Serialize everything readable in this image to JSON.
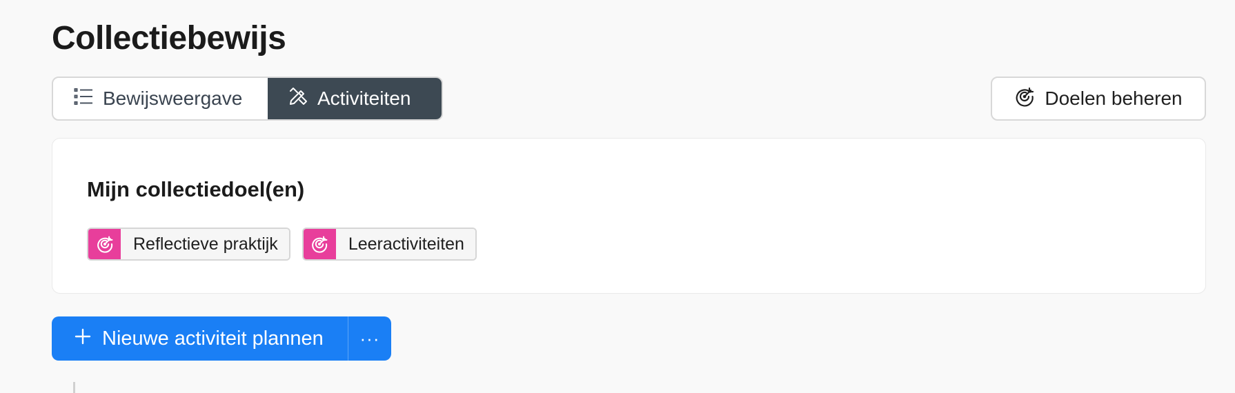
{
  "page": {
    "title": "Collectiebewijs"
  },
  "view_toggle": {
    "items": [
      {
        "label": "Bewijsweergave",
        "icon": "list-icon",
        "active": false
      },
      {
        "label": "Activiteiten",
        "icon": "tools-icon",
        "active": true
      }
    ]
  },
  "toolbar": {
    "manage_goals_label": "Doelen beheren",
    "manage_goals_icon": "target-icon"
  },
  "goals_card": {
    "title": "Mijn collectiedoel(en)",
    "goals": [
      {
        "label": "Reflectieve praktijk",
        "icon": "target-icon"
      },
      {
        "label": "Leeractiviteiten",
        "icon": "target-icon"
      }
    ],
    "accent_color": "#e83e9b"
  },
  "actions": {
    "new_activity_label": "Nieuwe activiteit plannen",
    "more_label": "···",
    "primary_color": "#1a7ff5"
  }
}
